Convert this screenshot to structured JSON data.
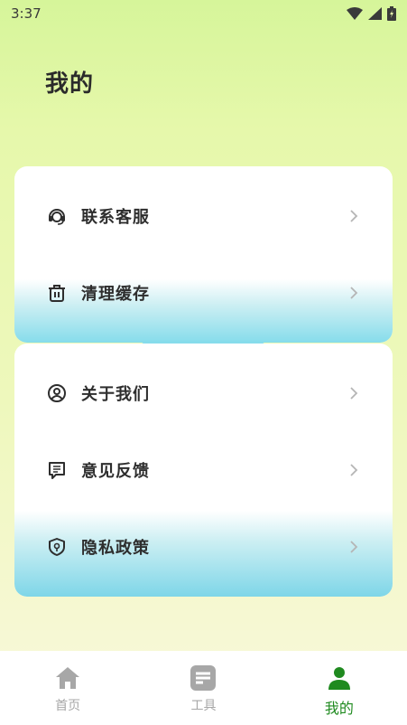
{
  "status_bar": {
    "time": "3:37"
  },
  "page": {
    "title": "我的"
  },
  "menu_group_1": [
    {
      "label": "联系客服",
      "icon": "headset-icon"
    },
    {
      "label": "清理缓存",
      "icon": "trash-icon"
    }
  ],
  "menu_group_2": [
    {
      "label": "关于我们",
      "icon": "user-circle-icon"
    },
    {
      "label": "意见反馈",
      "icon": "feedback-icon"
    },
    {
      "label": "隐私政策",
      "icon": "shield-icon"
    }
  ],
  "bottom_nav": [
    {
      "label": "首页",
      "icon": "home-icon",
      "active": false
    },
    {
      "label": "工具",
      "icon": "tools-icon",
      "active": false
    },
    {
      "label": "我的",
      "icon": "profile-icon",
      "active": true
    }
  ],
  "colors": {
    "accent": "#1f8a1f",
    "inactive": "#a7a7a7",
    "bg_top": "#d6f59a",
    "bg_bottom": "#f8f9dc"
  }
}
